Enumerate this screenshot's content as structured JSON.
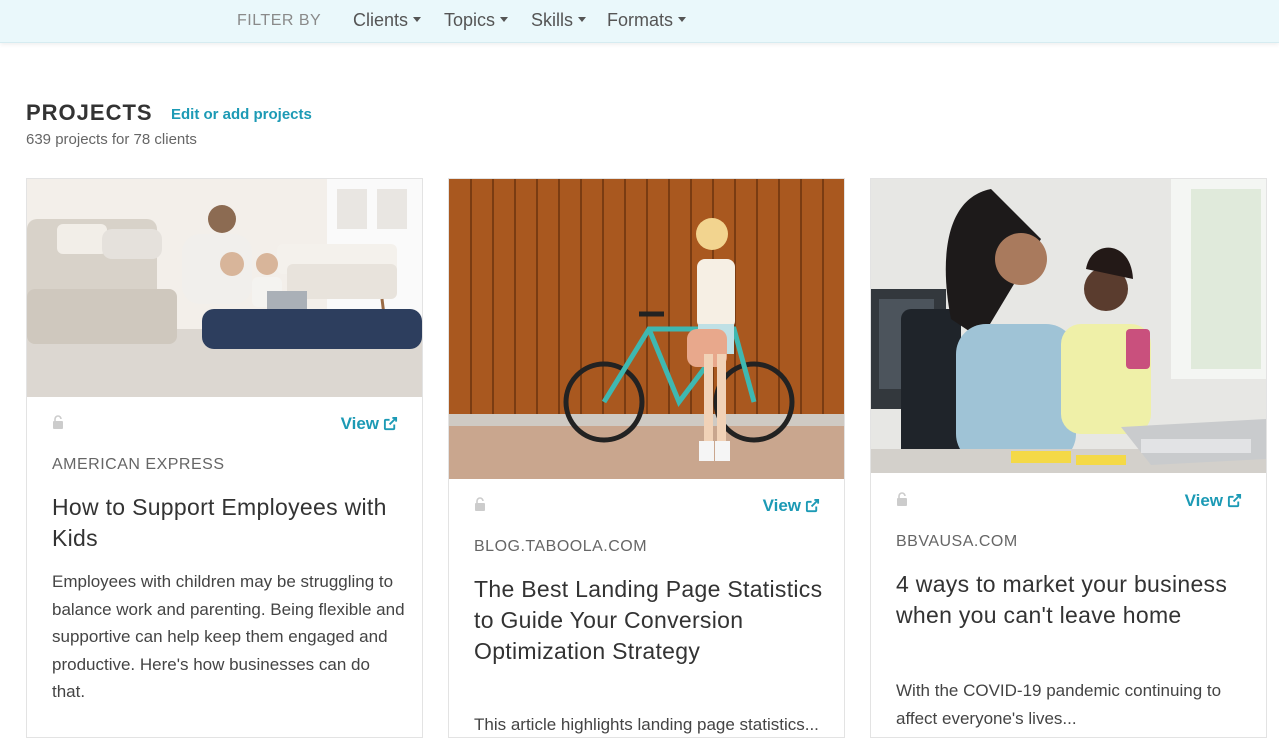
{
  "filter_bar": {
    "label": "FILTER BY",
    "dropdowns": [
      "Clients",
      "Topics",
      "Skills",
      "Formats"
    ]
  },
  "projects": {
    "title": "PROJECTS",
    "edit_link": "Edit or add projects",
    "count_text": "639 projects for 78 clients"
  },
  "cards": [
    {
      "view_label": "View",
      "client": "AMERICAN EXPRESS",
      "title": "How to Support Employees with Kids",
      "description": "Employees with children may be struggling to balance work and parenting. Being flexible and supportive can help keep them engaged and productive. Here's how businesses can do that."
    },
    {
      "view_label": "View",
      "client": "BLOG.TABOOLA.COM",
      "title": "The Best Landing Page Statistics to Guide Your Conversion Optimization Strategy",
      "description": "This article highlights landing page statistics..."
    },
    {
      "view_label": "View",
      "client": "BBVAUSA.COM",
      "title": "4 ways to market your business when you can't leave home",
      "description": "With the COVID-19 pandemic continuing to affect everyone's lives..."
    }
  ],
  "colors": {
    "accent": "#1c9ab5",
    "filter_bar_bg": "#eaf8fb"
  }
}
